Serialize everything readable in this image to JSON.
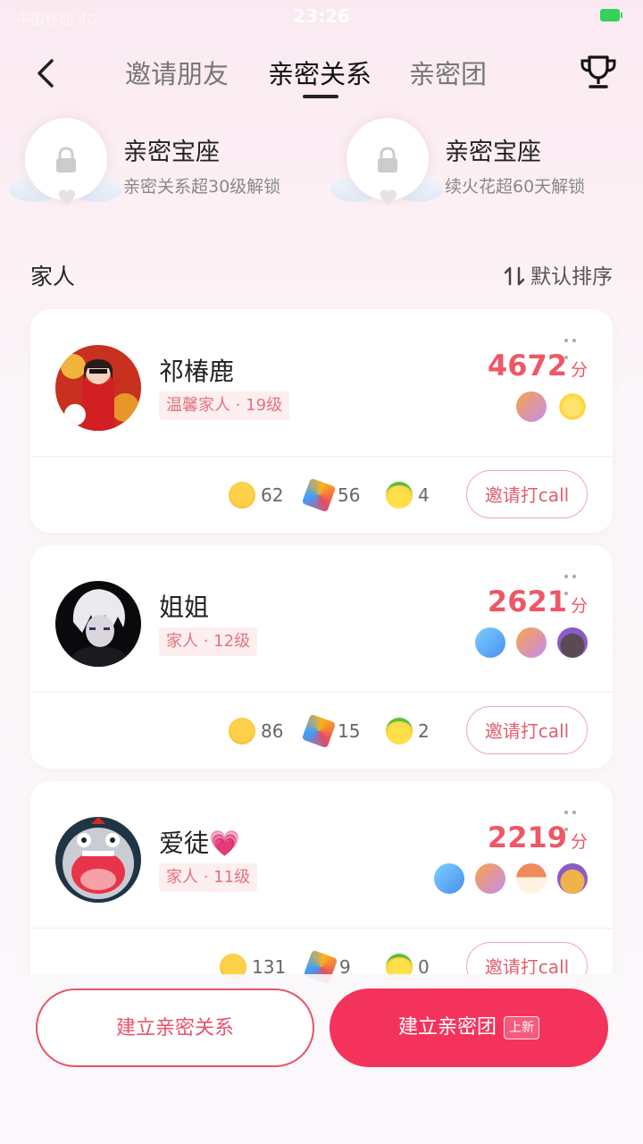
{
  "status_bar": {
    "time": "23:26",
    "left_text": "中国移动 4G"
  },
  "nav": {
    "tabs": [
      {
        "label": "邀请朋友"
      },
      {
        "label": "亲密关系"
      },
      {
        "label": "亲密团"
      }
    ],
    "active_tab": "亲密关系"
  },
  "seats": [
    {
      "title": "亲密宝座",
      "desc": "亲密关系超30级解锁"
    },
    {
      "title": "亲密宝座",
      "desc": "续火花超60天解锁"
    }
  ],
  "section": {
    "title": "家人",
    "sort_label": "默认排序"
  },
  "cards": [
    {
      "name": "祁椿鹿",
      "tag": "温馨家人 · 19级",
      "score": "4672",
      "unit": "分",
      "stats": [
        "62",
        "56",
        "4"
      ],
      "call_label": "邀请打call"
    },
    {
      "name": "姐姐",
      "tag": "家人 · 12级",
      "score": "2621",
      "unit": "分",
      "stats": [
        "86",
        "15",
        "2"
      ],
      "call_label": "邀请打call"
    },
    {
      "name": "爱徒💗",
      "tag": "家人 · 11级",
      "score": "2219",
      "unit": "分",
      "stats": [
        "131",
        "9",
        "0"
      ],
      "call_label": "邀请打call"
    }
  ],
  "bottom": {
    "build_relation_label": "建立亲密关系",
    "build_group_label": "建立亲密团",
    "new_badge": "上新"
  },
  "colors": {
    "accent": "#f4335d",
    "score": "#ef5767",
    "tag_bg": "#fdeef0"
  }
}
